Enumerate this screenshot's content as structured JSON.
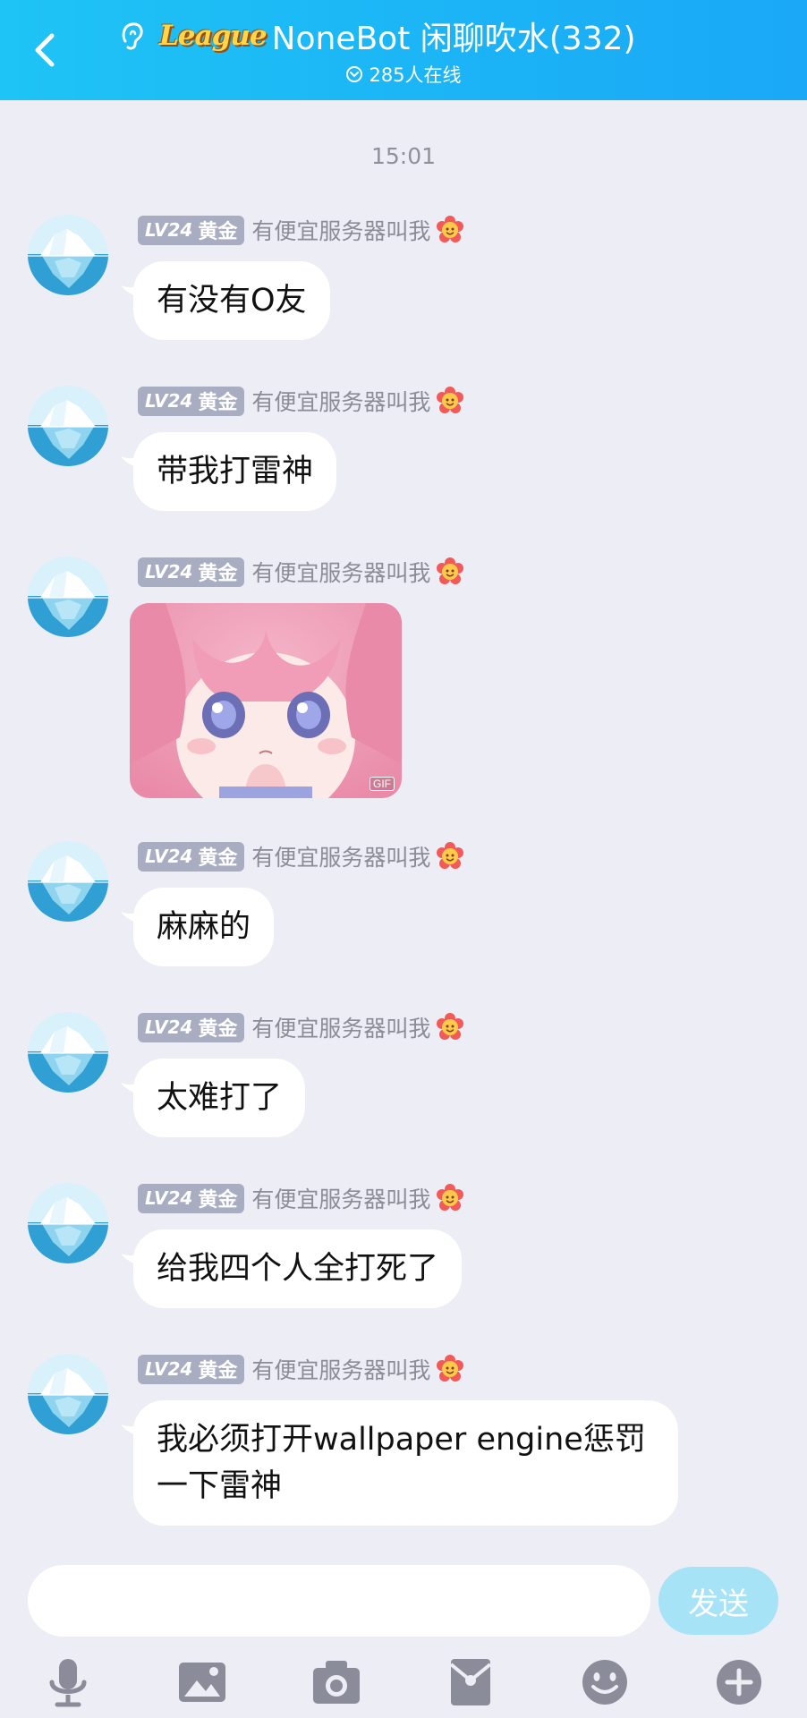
{
  "header": {
    "badge_text": "League",
    "title": "NoneBot 闲聊吹水(332)",
    "online": "285人在线"
  },
  "timestamp": "15:01",
  "messages": [
    {
      "level": "LV24",
      "rank": "黄金",
      "nickname": "有便宜服务器叫我",
      "text": "有没有O友"
    },
    {
      "level": "LV24",
      "rank": "黄金",
      "nickname": "有便宜服务器叫我",
      "text": "带我打雷神"
    },
    {
      "level": "LV24",
      "rank": "黄金",
      "nickname": "有便宜服务器叫我",
      "sticker": "GIF"
    },
    {
      "level": "LV24",
      "rank": "黄金",
      "nickname": "有便宜服务器叫我",
      "text": "麻麻的"
    },
    {
      "level": "LV24",
      "rank": "黄金",
      "nickname": "有便宜服务器叫我",
      "text": "太难打了"
    },
    {
      "level": "LV24",
      "rank": "黄金",
      "nickname": "有便宜服务器叫我",
      "text": "给我四个人全打死了"
    },
    {
      "level": "LV24",
      "rank": "黄金",
      "nickname": "有便宜服务器叫我",
      "text": "我必须打开wallpaper engine惩罚一下雷神"
    }
  ],
  "composer": {
    "placeholder": "",
    "send_label": "发送"
  },
  "toolbar": [
    "microphone-icon",
    "image-icon",
    "camera-icon",
    "red-envelope-icon",
    "emoji-icon",
    "plus-icon"
  ],
  "colors": {
    "header_start": "#1ec4f5",
    "header_end": "#1aa8f7",
    "background": "#ededf5",
    "level_badge": "#a9adc1",
    "send_button": "#a6e3f6",
    "toolbar_icon": "#8a8c99"
  }
}
